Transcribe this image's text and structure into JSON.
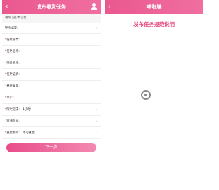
{
  "left_screen": {
    "title": "发布悬赏任务",
    "hint": "请填写基本信息",
    "fields": [
      {
        "label": "任务类型:",
        "value": "",
        "placeholder": "",
        "required": false,
        "chevron": true
      },
      {
        "label": "任务分类:",
        "value": "",
        "placeholder": "",
        "required": true,
        "chevron": false
      },
      {
        "label": "任务名称:",
        "value": "",
        "placeholder": "",
        "required": true,
        "chevron": false
      },
      {
        "label": "项目名称:",
        "value": "",
        "placeholder": "",
        "required": true,
        "chevron": false
      },
      {
        "label": "任务说明:",
        "value": "",
        "placeholder": "",
        "required": true,
        "chevron": false
      },
      {
        "label": "悬赏数量:",
        "value": "",
        "placeholder": "",
        "required": true,
        "chevron": false
      },
      {
        "label": "单价:",
        "value": "",
        "placeholder": "",
        "required": true,
        "chevron": false
      },
      {
        "label": "限时完成:",
        "value": "1小时",
        "placeholder": "",
        "required": true,
        "chevron": true
      },
      {
        "label": "审核时间:",
        "value": "",
        "placeholder": "",
        "required": true,
        "chevron": true
      },
      {
        "label": "重复接单:",
        "value": "不可重复",
        "placeholder": "",
        "required": true,
        "chevron": true
      }
    ],
    "next_button": "下一步",
    "notes": [
      "",
      "",
      ""
    ]
  },
  "right_screen": {
    "title": "哆啦赚",
    "doc_title": "发布任务规范说明",
    "paragraphs": [
      {
        "text": "",
        "highlight": ""
      },
      {
        "text": "",
        "highlight": ""
      },
      {
        "text": "",
        "highlight": ""
      },
      {
        "text": "",
        "highlight": ""
      },
      {
        "text": "",
        "highlight": ""
      },
      {
        "text": "",
        "highlight": ""
      }
    ]
  },
  "watermark": {
    "main": "",
    "sub": ""
  },
  "colors": {
    "accent": "#e9588f",
    "accent_light": "#f38ab0",
    "divider": "#eeeeee"
  },
  "icons": {
    "back": "back-arrow-icon",
    "user": "user-icon",
    "chevron": "chevron-right-icon"
  }
}
